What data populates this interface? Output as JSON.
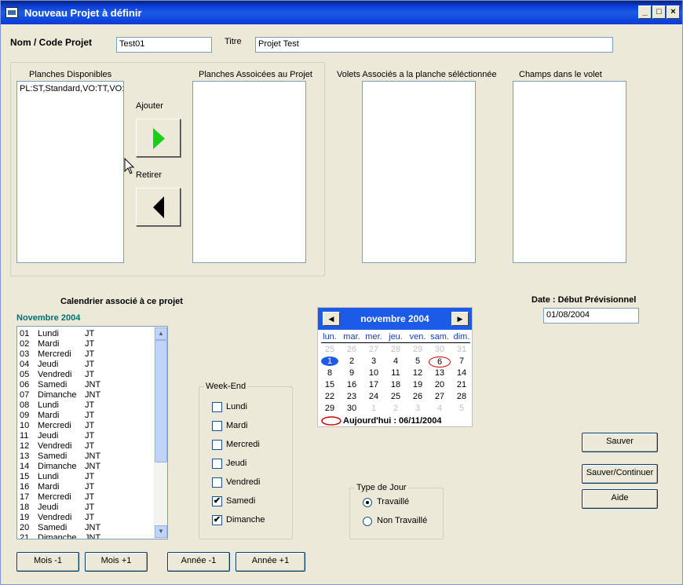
{
  "window": {
    "title": "Nouveau Projet à définir",
    "min": "_",
    "max": "□",
    "close": "×"
  },
  "project": {
    "code_label": "Nom / Code Projet",
    "code_value": "Test01",
    "title_label": "Titre",
    "title_value": "Projet Test"
  },
  "planches": {
    "available_header": "Planches Disponibles",
    "available_items": [
      "PL:ST,Standard,VO:TT,VO:"
    ],
    "add_label": "Ajouter",
    "remove_label": "Retirer",
    "associated_header": "Planches Assoicées au Projet",
    "volets_header": "Volets Associés a la planche séléctionnée",
    "champs_header": "Champs dans le volet"
  },
  "calendar_list": {
    "title": "Calendrier associé à ce projet",
    "month": "Novembre 2004",
    "rows": [
      [
        "01",
        "Lundi",
        "JT"
      ],
      [
        "02",
        "Mardi",
        "JT"
      ],
      [
        "03",
        "Mercredi",
        "JT"
      ],
      [
        "04",
        "Jeudi",
        "JT"
      ],
      [
        "05",
        "Vendredi",
        "JT"
      ],
      [
        "06",
        "Samedi",
        "JNT"
      ],
      [
        "07",
        "Dimanche",
        "JNT"
      ],
      [
        "08",
        "Lundi",
        "JT"
      ],
      [
        "09",
        "Mardi",
        "JT"
      ],
      [
        "10",
        "Mercredi",
        "JT"
      ],
      [
        "11",
        "Jeudi",
        "JT"
      ],
      [
        "12",
        "Vendredi",
        "JT"
      ],
      [
        "13",
        "Samedi",
        "JNT"
      ],
      [
        "14",
        "Dimanche",
        "JNT"
      ],
      [
        "15",
        "Lundi",
        "JT"
      ],
      [
        "16",
        "Mardi",
        "JT"
      ],
      [
        "17",
        "Mercredi",
        "JT"
      ],
      [
        "18",
        "Jeudi",
        "JT"
      ],
      [
        "19",
        "Vendredi",
        "JT"
      ],
      [
        "20",
        "Samedi",
        "JNT"
      ],
      [
        "21",
        "Dimanche",
        "JNT"
      ]
    ]
  },
  "weekend": {
    "title": "Week-End",
    "days": [
      {
        "label": "Lundi",
        "checked": false
      },
      {
        "label": "Mardi",
        "checked": false
      },
      {
        "label": "Mercredi",
        "checked": false
      },
      {
        "label": "Jeudi",
        "checked": false
      },
      {
        "label": "Vendredi",
        "checked": false
      },
      {
        "label": "Samedi",
        "checked": true
      },
      {
        "label": "Dimanche",
        "checked": true
      }
    ]
  },
  "month_calendar": {
    "month": "novembre 2004",
    "prev": "◀",
    "next": "▶",
    "dow": [
      "lun.",
      "mar.",
      "mer.",
      "jeu.",
      "ven.",
      "sam.",
      "dim."
    ],
    "weeks": [
      [
        "25",
        "26",
        "27",
        "28",
        "29",
        "30",
        "31"
      ],
      [
        "1",
        "2",
        "3",
        "4",
        "5",
        "6",
        "7"
      ],
      [
        "8",
        "9",
        "10",
        "11",
        "12",
        "13",
        "14"
      ],
      [
        "15",
        "16",
        "17",
        "18",
        "19",
        "20",
        "21"
      ],
      [
        "22",
        "23",
        "24",
        "25",
        "26",
        "27",
        "28"
      ],
      [
        "29",
        "30",
        "1",
        "2",
        "3",
        "4",
        "5"
      ]
    ],
    "selected_day": "1",
    "today_day": "6",
    "today_label": "Aujourd'hui : 06/11/2004",
    "accent": "#1c5ae8",
    "today_color": "#d00000"
  },
  "date_debut": {
    "label": "Date : Début Prévisionnel",
    "value": "01/08/2004"
  },
  "type_jour": {
    "title": "Type de Jour",
    "options": [
      "Travaillé",
      "Non Travaillé"
    ],
    "selected": "Travaillé"
  },
  "buttons": {
    "save": "Sauver",
    "save_continue": "Sauver/Continuer",
    "help": "Aide",
    "month_prev": "Mois -1",
    "month_next": "Mois +1",
    "year_prev": "Année -1",
    "year_next": "Année +1"
  }
}
